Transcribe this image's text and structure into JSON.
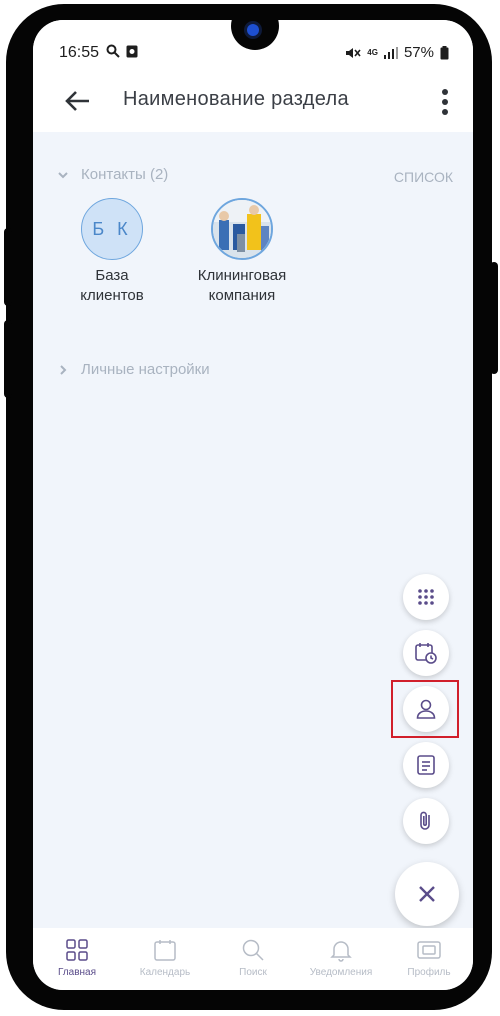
{
  "status": {
    "time": "16:55",
    "battery": "57%",
    "network": "4G"
  },
  "appbar": {
    "title": "Наименование раздела"
  },
  "contacts_section": {
    "label": "Контакты (2)",
    "view_link": "СПИСОК",
    "items": [
      {
        "name_line1": "База",
        "name_line2": "клиентов",
        "initials": "Б К"
      },
      {
        "name_line1": "Клининговая",
        "name_line2": "компания"
      }
    ]
  },
  "personal_section": {
    "label": "Личные настройки"
  },
  "fab": {
    "actions": [
      "apps-grid-icon",
      "calendar-clock-icon",
      "person-icon",
      "note-icon",
      "paperclip-icon"
    ],
    "close": "close-icon",
    "highlighted": "person-icon"
  },
  "bottom_nav": [
    {
      "label": "Главная",
      "icon": "home-grid-icon",
      "active": true
    },
    {
      "label": "Календарь",
      "icon": "calendar-icon",
      "active": false
    },
    {
      "label": "Поиск",
      "icon": "search-icon",
      "active": false
    },
    {
      "label": "Уведомления",
      "icon": "bell-icon",
      "active": false
    },
    {
      "label": "Профиль",
      "icon": "profile-card-icon",
      "active": false
    }
  ],
  "colors": {
    "accent": "#5a4c8a",
    "highlight": "#d11f2b",
    "background": "#f1f5fb",
    "muted": "#a9b3c0"
  }
}
